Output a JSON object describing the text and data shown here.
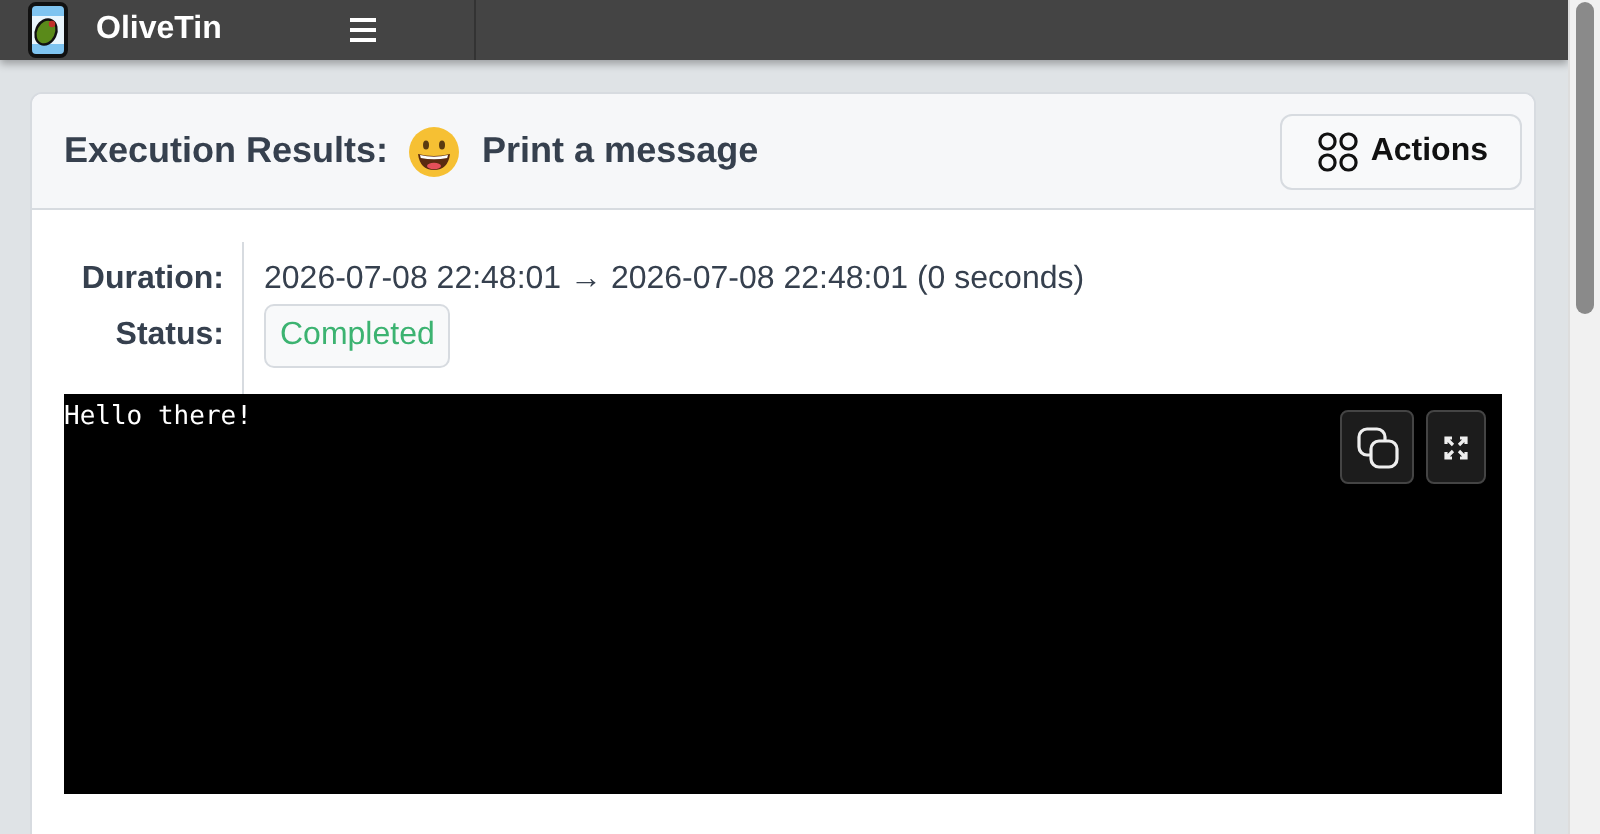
{
  "header": {
    "title": "OliveTin"
  },
  "card": {
    "title": "Execution Results:",
    "action_title": "Print a message",
    "actions_button": "Actions",
    "fields": [
      {
        "label": "Duration:",
        "kind": "text",
        "value": "2026-07-08 22:48:01 → 2026-07-08 22:48:01 (0 seconds)"
      },
      {
        "label": "Status:",
        "kind": "badge",
        "value": "Completed",
        "color": "#3cb371"
      }
    ],
    "output": "Hello there!"
  }
}
